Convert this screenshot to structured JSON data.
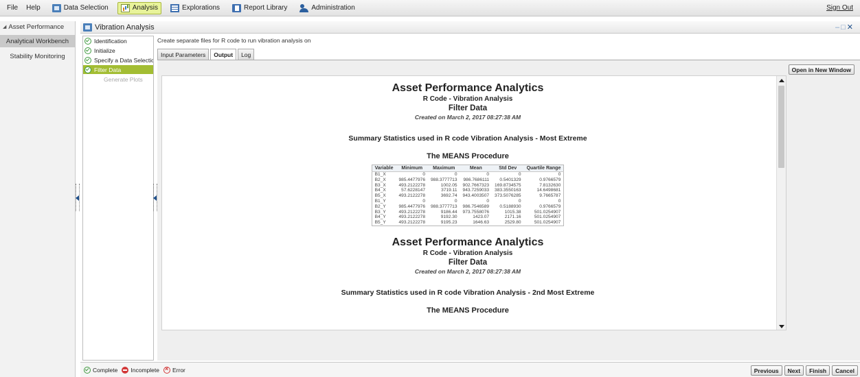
{
  "menubar": {
    "file": "File",
    "help": "Help",
    "items": [
      {
        "label": "Data Selection",
        "icon": "data-selection-icon"
      },
      {
        "label": "Analysis",
        "icon": "analysis-icon"
      },
      {
        "label": "Explorations",
        "icon": "explorations-icon"
      },
      {
        "label": "Report Library",
        "icon": "report-library-icon"
      },
      {
        "label": "Administration",
        "icon": "administration-icon"
      }
    ],
    "active_item": "Analysis",
    "sign_out": "Sign Out"
  },
  "sidebar": {
    "header": "Asset Performance",
    "items": [
      {
        "label": "Analytical Workbench",
        "selected": true
      },
      {
        "label": "Stability Monitoring",
        "selected": false
      }
    ]
  },
  "window": {
    "title": "Vibration Analysis"
  },
  "steps": [
    {
      "label": "Identification",
      "status": "complete"
    },
    {
      "label": "Initialize",
      "status": "complete"
    },
    {
      "label": "Specify a Data Selectio",
      "status": "complete"
    },
    {
      "label": "Filter Data",
      "status": "current"
    },
    {
      "label": "Generate Plots",
      "status": "pending"
    }
  ],
  "content": {
    "description": "Create separate files for R code to run vibration analysis on",
    "tabs": [
      "Input Parameters",
      "Output",
      "Log"
    ],
    "active_tab": "Output",
    "open_new_window": "Open in New Window"
  },
  "report": {
    "sections": [
      {
        "title": "Asset Performance Analytics",
        "subtitle": "R Code - Vibration Analysis",
        "subtitle2": "Filter Data",
        "created": "Created on March 2, 2017 08:27:38 AM",
        "summary": "Summary Statistics used in R code Vibration Analysis - Most Extreme",
        "procedure": "The MEANS Procedure"
      },
      {
        "title": "Asset Performance Analytics",
        "subtitle": "R Code - Vibration Analysis",
        "subtitle2": "Filter Data",
        "created": "Created on March 2, 2017 08:27:38 AM",
        "summary": "Summary Statistics used in R code Vibration Analysis - 2nd Most Extreme",
        "procedure": "The MEANS Procedure"
      }
    ],
    "table": {
      "headers": [
        "Variable",
        "Minimum",
        "Maximum",
        "Mean",
        "Std Dev",
        "Quartile Range"
      ],
      "rows": [
        [
          "B1_X",
          "0",
          "0",
          "0",
          "0",
          "0"
        ],
        [
          "B2_X",
          "985.4477976",
          "988.3777713",
          "986.7686111",
          "0.5401329",
          "0.9766579"
        ],
        [
          "B3_X",
          "493.2122278",
          "1002.05",
          "902.7667323",
          "169.8734575",
          "7.8132630"
        ],
        [
          "B4_X",
          "57.6228147",
          "3719.11",
          "943.7259033",
          "383.3550163",
          "14.6498681"
        ],
        [
          "B5_X",
          "493.2122278",
          "3692.74",
          "943.4003507",
          "373.5076285",
          "9.7665787"
        ],
        [
          "B1_Y",
          "0",
          "0",
          "0",
          "0",
          "0"
        ],
        [
          "B2_Y",
          "985.4477976",
          "988.3777713",
          "986.7546589",
          "0.5188930",
          "0.9766579"
        ],
        [
          "B3_Y",
          "493.2122278",
          "9186.44",
          "973.7558076",
          "1015.38",
          "501.0254907"
        ],
        [
          "B4_Y",
          "493.2122278",
          "9192.30",
          "1423.07",
          "2171.16",
          "501.0254907"
        ],
        [
          "B5_Y",
          "493.2122278",
          "9195.23",
          "1646.63",
          "2529.80",
          "501.0254907"
        ]
      ]
    }
  },
  "legend": [
    {
      "label": "Complete",
      "status": "complete"
    },
    {
      "label": "Incomplete",
      "status": "incomplete"
    },
    {
      "label": "Error",
      "status": "error"
    }
  ],
  "footer_buttons": [
    "Previous",
    "Next",
    "Finish",
    "Cancel"
  ],
  "colors": {
    "active_step": "#a3bd33",
    "active_menu": "#e8f39a",
    "complete": "#3f9a3f",
    "error": "#d23838"
  }
}
